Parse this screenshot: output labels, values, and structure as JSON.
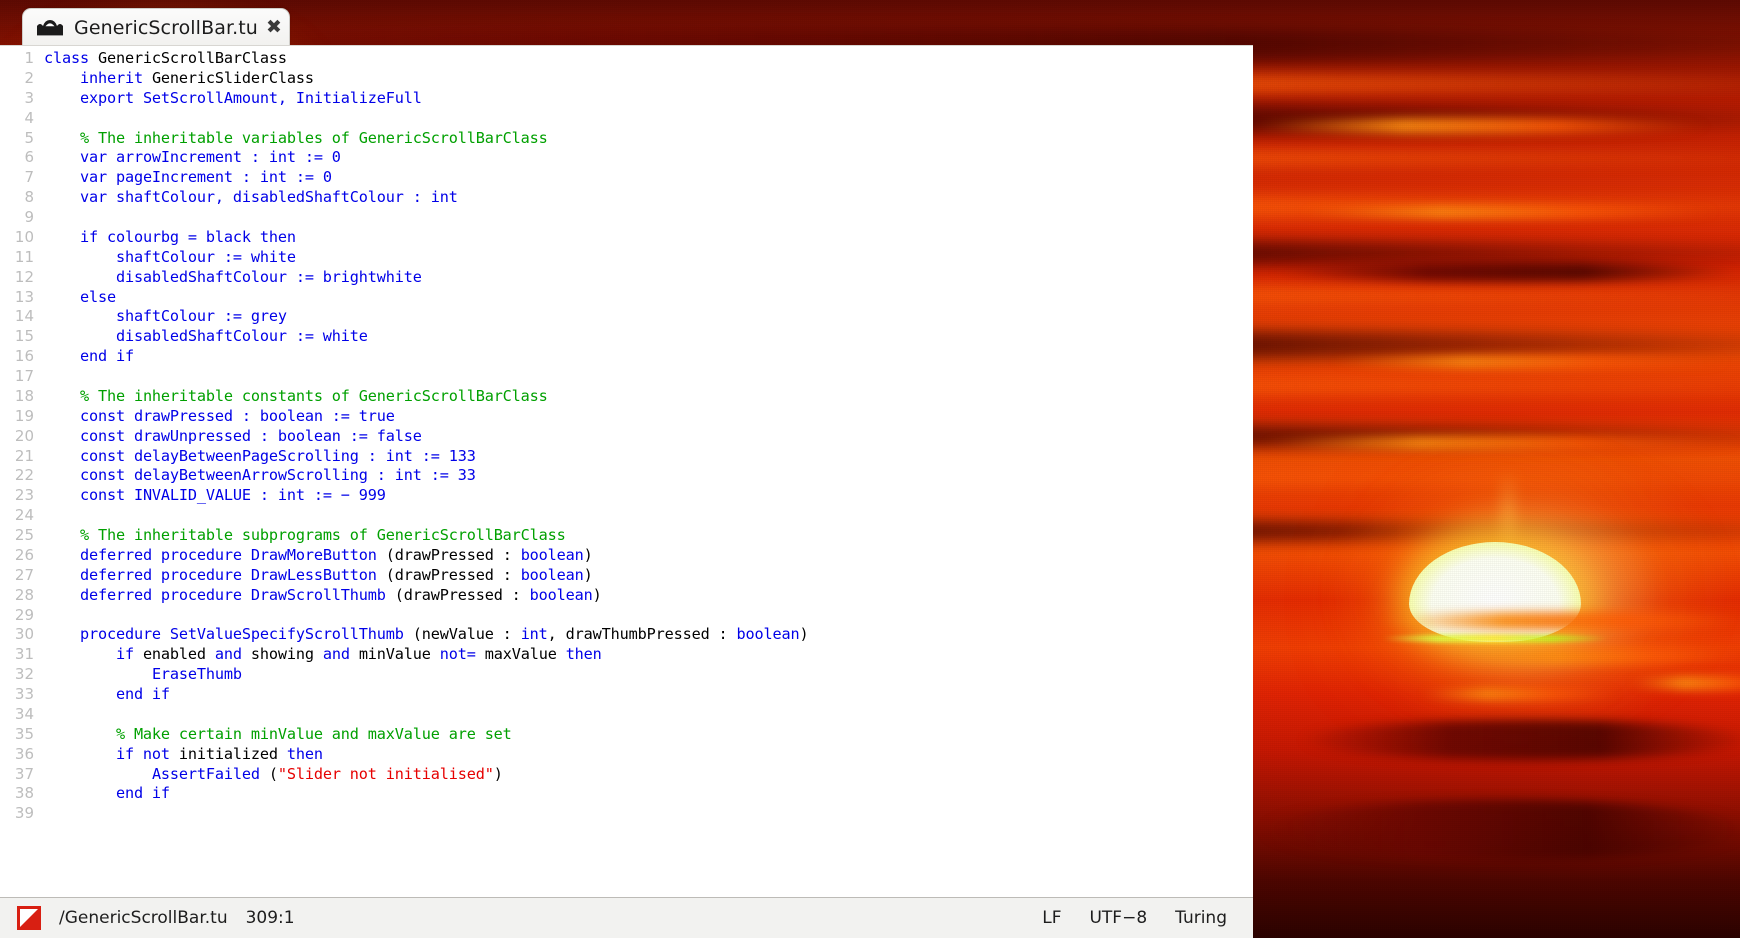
{
  "window": {
    "tab": {
      "label": "GenericScrollBar.tu",
      "icon": "mountain-sun-icon",
      "close_label": "✖"
    }
  },
  "editor": {
    "first_line_number": 1,
    "visible_lines": 39,
    "lines": [
      {
        "n": 1,
        "tokens": [
          {
            "t": "kw",
            "v": "class "
          },
          {
            "t": "id",
            "v": "GenericScrollBarClass"
          }
        ]
      },
      {
        "n": 2,
        "tokens": [
          {
            "t": "id",
            "v": "    "
          },
          {
            "t": "kw",
            "v": "inherit "
          },
          {
            "t": "id",
            "v": "GenericSliderClass"
          }
        ]
      },
      {
        "n": 3,
        "tokens": [
          {
            "t": "id",
            "v": "    "
          },
          {
            "t": "kw",
            "v": "export SetScrollAmount, InitializeFull"
          }
        ]
      },
      {
        "n": 4,
        "tokens": []
      },
      {
        "n": 5,
        "tokens": [
          {
            "t": "id",
            "v": "    "
          },
          {
            "t": "cm",
            "v": "% The inheritable variables of GenericScrollBarClass"
          }
        ]
      },
      {
        "n": 6,
        "tokens": [
          {
            "t": "id",
            "v": "    "
          },
          {
            "t": "kw",
            "v": "var arrowIncrement : int := 0"
          }
        ]
      },
      {
        "n": 7,
        "tokens": [
          {
            "t": "id",
            "v": "    "
          },
          {
            "t": "kw",
            "v": "var pageIncrement : int := 0"
          }
        ]
      },
      {
        "n": 8,
        "tokens": [
          {
            "t": "id",
            "v": "    "
          },
          {
            "t": "kw",
            "v": "var shaftColour, disabledShaftColour : int"
          }
        ]
      },
      {
        "n": 9,
        "tokens": []
      },
      {
        "n": 10,
        "tokens": [
          {
            "t": "id",
            "v": "    "
          },
          {
            "t": "kw",
            "v": "if colourbg = black then"
          }
        ]
      },
      {
        "n": 11,
        "tokens": [
          {
            "t": "id",
            "v": "        "
          },
          {
            "t": "kw",
            "v": "shaftColour := white"
          }
        ]
      },
      {
        "n": 12,
        "tokens": [
          {
            "t": "id",
            "v": "        "
          },
          {
            "t": "kw",
            "v": "disabledShaftColour := brightwhite"
          }
        ]
      },
      {
        "n": 13,
        "tokens": [
          {
            "t": "id",
            "v": "    "
          },
          {
            "t": "kw",
            "v": "else"
          }
        ]
      },
      {
        "n": 14,
        "tokens": [
          {
            "t": "id",
            "v": "        "
          },
          {
            "t": "kw",
            "v": "shaftColour := grey"
          }
        ]
      },
      {
        "n": 15,
        "tokens": [
          {
            "t": "id",
            "v": "        "
          },
          {
            "t": "kw",
            "v": "disabledShaftColour := white"
          }
        ]
      },
      {
        "n": 16,
        "tokens": [
          {
            "t": "id",
            "v": "    "
          },
          {
            "t": "kw",
            "v": "end if"
          }
        ]
      },
      {
        "n": 17,
        "tokens": []
      },
      {
        "n": 18,
        "tokens": [
          {
            "t": "id",
            "v": "    "
          },
          {
            "t": "cm",
            "v": "% The inheritable constants of GenericScrollBarClass"
          }
        ]
      },
      {
        "n": 19,
        "tokens": [
          {
            "t": "id",
            "v": "    "
          },
          {
            "t": "kw",
            "v": "const drawPressed : boolean := true"
          }
        ]
      },
      {
        "n": 20,
        "tokens": [
          {
            "t": "id",
            "v": "    "
          },
          {
            "t": "kw",
            "v": "const drawUnpressed : boolean := false"
          }
        ]
      },
      {
        "n": 21,
        "tokens": [
          {
            "t": "id",
            "v": "    "
          },
          {
            "t": "kw",
            "v": "const delayBetweenPageScrolling : int := 133"
          }
        ]
      },
      {
        "n": 22,
        "tokens": [
          {
            "t": "id",
            "v": "    "
          },
          {
            "t": "kw",
            "v": "const delayBetweenArrowScrolling : int := 33"
          }
        ]
      },
      {
        "n": 23,
        "tokens": [
          {
            "t": "id",
            "v": "    "
          },
          {
            "t": "kw",
            "v": "const INVALID_VALUE : int := − 999"
          }
        ]
      },
      {
        "n": 24,
        "tokens": []
      },
      {
        "n": 25,
        "tokens": [
          {
            "t": "id",
            "v": "    "
          },
          {
            "t": "cm",
            "v": "% The inheritable subprograms of GenericScrollBarClass"
          }
        ]
      },
      {
        "n": 26,
        "tokens": [
          {
            "t": "id",
            "v": "    "
          },
          {
            "t": "kw",
            "v": "deferred procedure DrawMoreButton "
          },
          {
            "t": "id",
            "v": "(drawPressed : "
          },
          {
            "t": "kw",
            "v": "boolean"
          },
          {
            "t": "id",
            "v": ")"
          }
        ]
      },
      {
        "n": 27,
        "tokens": [
          {
            "t": "id",
            "v": "    "
          },
          {
            "t": "kw",
            "v": "deferred procedure DrawLessButton "
          },
          {
            "t": "id",
            "v": "(drawPressed : "
          },
          {
            "t": "kw",
            "v": "boolean"
          },
          {
            "t": "id",
            "v": ")"
          }
        ]
      },
      {
        "n": 28,
        "tokens": [
          {
            "t": "id",
            "v": "    "
          },
          {
            "t": "kw",
            "v": "deferred procedure DrawScrollThumb "
          },
          {
            "t": "id",
            "v": "(drawPressed : "
          },
          {
            "t": "kw",
            "v": "boolean"
          },
          {
            "t": "id",
            "v": ")"
          }
        ]
      },
      {
        "n": 29,
        "tokens": []
      },
      {
        "n": 30,
        "tokens": [
          {
            "t": "id",
            "v": "    "
          },
          {
            "t": "kw",
            "v": "procedure SetValueSpecifyScrollThumb "
          },
          {
            "t": "id",
            "v": "(newValue : "
          },
          {
            "t": "kw",
            "v": "int"
          },
          {
            "t": "id",
            "v": ", drawThumbPressed : "
          },
          {
            "t": "kw",
            "v": "boolean"
          },
          {
            "t": "id",
            "v": ")"
          }
        ]
      },
      {
        "n": 31,
        "tokens": [
          {
            "t": "id",
            "v": "        "
          },
          {
            "t": "kw",
            "v": "if "
          },
          {
            "t": "id",
            "v": "enabled "
          },
          {
            "t": "kw",
            "v": "and "
          },
          {
            "t": "id",
            "v": "showing "
          },
          {
            "t": "kw",
            "v": "and "
          },
          {
            "t": "id",
            "v": "minValue "
          },
          {
            "t": "kw",
            "v": "not= "
          },
          {
            "t": "id",
            "v": "maxValue "
          },
          {
            "t": "kw",
            "v": "then"
          }
        ]
      },
      {
        "n": 32,
        "tokens": [
          {
            "t": "id",
            "v": "            "
          },
          {
            "t": "kw",
            "v": "EraseThumb"
          }
        ]
      },
      {
        "n": 33,
        "tokens": [
          {
            "t": "id",
            "v": "        "
          },
          {
            "t": "kw",
            "v": "end if"
          }
        ]
      },
      {
        "n": 34,
        "tokens": []
      },
      {
        "n": 35,
        "tokens": [
          {
            "t": "id",
            "v": "        "
          },
          {
            "t": "cm",
            "v": "% Make certain minValue and maxValue are set"
          }
        ]
      },
      {
        "n": 36,
        "tokens": [
          {
            "t": "id",
            "v": "        "
          },
          {
            "t": "kw",
            "v": "if not "
          },
          {
            "t": "id",
            "v": "initialized "
          },
          {
            "t": "kw",
            "v": "then"
          }
        ]
      },
      {
        "n": 37,
        "tokens": [
          {
            "t": "id",
            "v": "            "
          },
          {
            "t": "kw",
            "v": "AssertFailed "
          },
          {
            "t": "id",
            "v": "("
          },
          {
            "t": "st",
            "v": "\"Slider not initialised\""
          },
          {
            "t": "id",
            "v": ")"
          }
        ]
      },
      {
        "n": 38,
        "tokens": [
          {
            "t": "id",
            "v": "        "
          },
          {
            "t": "kw",
            "v": "end if"
          }
        ]
      },
      {
        "n": 39,
        "tokens": []
      }
    ]
  },
  "statusbar": {
    "icon": "turing-file-icon",
    "path": "/GenericScrollBar.tu",
    "cursor_position": "309:1",
    "line_ending": "LF",
    "encoding": "UTF−8",
    "language": "Turing"
  },
  "colors": {
    "keyword": "#0000e8",
    "comment": "#00a000",
    "string": "#e60000",
    "identifier": "#000000",
    "line_number": "#bdbdbd",
    "editor_background": "#ffffff",
    "statusbar_background": "#f2f2f0",
    "tab_background": "#f7f6f4",
    "status_icon_red": "#d81f12"
  },
  "wallpaper": {
    "description": "red-sunset-photo",
    "sun_color": "#ffffff",
    "sky_top": "#5e0a03",
    "sky_mid": "#ef4a05",
    "sky_bottom": "#2c0300"
  }
}
